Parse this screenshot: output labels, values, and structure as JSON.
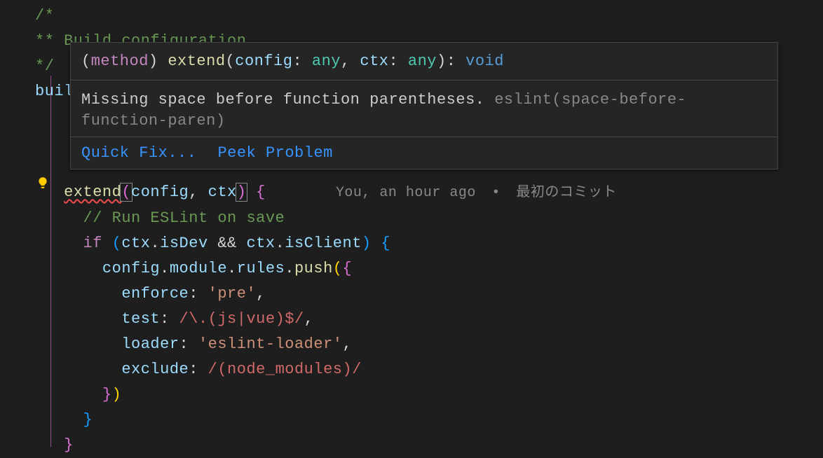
{
  "code": {
    "comment_open": "/*",
    "comment_line": "** Build configuration",
    "comment_close": "*/",
    "build_key": "build",
    "extend": "extend",
    "config": "config",
    "ctx": "ctx",
    "run_eslint_comment": "// Run ESLint on save",
    "if_kw": "if",
    "isDev": "isDev",
    "isClient": "isClient",
    "module": "module",
    "rules": "rules",
    "push": "push",
    "enforce_key": "enforce",
    "enforce_val": "'pre'",
    "test_key": "test",
    "test_regex": "/\\.(js|vue)$/",
    "loader_key": "loader",
    "loader_val": "'eslint-loader'",
    "exclude_key": "exclude",
    "exclude_regex": "/(node_modules)/"
  },
  "hover": {
    "sig_open": "(",
    "sig_method": "method",
    "sig_close_paren": ") ",
    "sig_name": "extend",
    "sig_lparen": "(",
    "sig_param1": "config",
    "sig_colon": ": ",
    "sig_type": "any",
    "sig_comma": ", ",
    "sig_param2": "ctx",
    "sig_rparen": ")",
    "sig_ret": ": ",
    "sig_void": "void",
    "message": "Missing space before function parentheses. ",
    "rule": "eslint(space-before-function-paren)",
    "quick_fix": "Quick Fix...",
    "peek_problem": "Peek Problem"
  },
  "codelens": {
    "author": "You, an hour ago",
    "sep": " • ",
    "commit": "最初のコミット"
  }
}
